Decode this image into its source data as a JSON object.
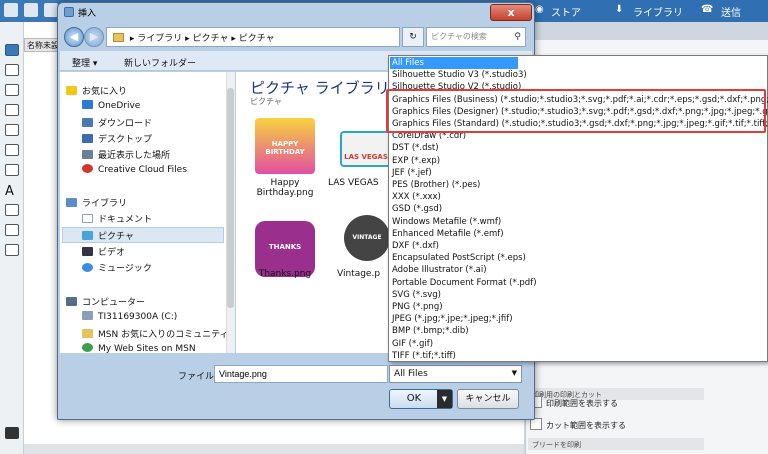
{
  "app": {
    "store_label": "ストア",
    "library_label": "ライブラリ",
    "send_label": "送信",
    "doc_tab": "名称未設"
  },
  "panel": {
    "print_section": "印刷用の印刷とカット",
    "show_print_area": "印刷範囲を表示する",
    "show_cut_area": "カット範囲を表示する",
    "blade_section": "ブリードを印刷"
  },
  "dialog": {
    "title": "挿入",
    "close": "x",
    "address": [
      "ライブラリ",
      "ピクチャ",
      "ピクチャ"
    ],
    "search_placeholder": "ピクチャの検索",
    "toolbar": {
      "organize": "整理 ▾",
      "new_folder": "新しいフォルダー"
    },
    "sidebar": {
      "favorites": "お気に入り",
      "onedrive": "OneDrive",
      "downloads": "ダウンロード",
      "desktop": "デスクトップ",
      "recent": "最近表示した場所",
      "creative_cloud": "Creative Cloud Files",
      "libraries": "ライブラリ",
      "documents": "ドキュメント",
      "pictures": "ピクチャ",
      "videos": "ビデオ",
      "music": "ミュージック",
      "computer": "コンピューター",
      "drive_c": "TI31169300A (C:)",
      "msn_community": "MSN お気に入りのコミュニティ",
      "msn_sites": "My Web Sites on MSN"
    },
    "library_title": "ピクチャ ライブラリ",
    "library_subtitle": "ピクチャ",
    "files": [
      {
        "name": "Happy\nBirthday.png",
        "thumb": "HAPPY BIRTHDAY"
      },
      {
        "name": "LAS VEGAS",
        "thumb": "LAS VEGAS"
      },
      {
        "name": "Thanks.png",
        "thumb": "THANKS"
      },
      {
        "name": "Vintage.p",
        "thumb": "VINTAGE"
      }
    ],
    "filename_label": "ファイル名(N):",
    "filename_value": "Vintage.png",
    "filetype_value": "All Files",
    "ok_label": "OK",
    "cancel_label": "キャンセル"
  },
  "filetype_options": [
    "All Files",
    "Silhouette Studio V3 (*.studio3)",
    "Silhouette Studio V2 (*.studio)",
    "Graphics Files (Business) (*.studio;*.studio3;*.svg;*.pdf;*.ai;*.cdr;*.eps;*.gsd;*.dxf;*.png;*.j",
    "Graphics Files (Designer) (*.studio;*.studio3;*.svg;*.pdf;*.gsd;*.dxf;*.png;*.jpg;*.jpeg;*.gif;*",
    "Graphics Files (Standard) (*.studio;*.studio3;*.gsd;*.dxf;*.png;*.jpg;*.jpeg;*.gif;*.tif;*.tiff;*.",
    "CorelDraw (*.cdr)",
    "DST (*.dst)",
    "EXP (*.exp)",
    "JEF (*.jef)",
    "PES (Brother) (*.pes)",
    "XXX (*.xxx)",
    "GSD (*.gsd)",
    "Windows Metafile (*.wmf)",
    "Enhanced Metafile (*.emf)",
    "DXF (*.dxf)",
    "Encapsulated PostScript (*.eps)",
    "Adobe Illustrator (*.ai)",
    "Portable Document Format (*.pdf)",
    "SVG (*.svg)",
    "PNG (*.png)",
    "JPEG (*.jpg;*.jpe;*.jpeg;*.jfif)",
    "BMP (*.bmp;*.dib)",
    "GIF (*.gif)",
    "TIFF (*.tif;*.tiff)"
  ],
  "colors": {
    "accent": "#3399ff",
    "highlight_box": "#e23b3b",
    "title_blue": "#1e3287"
  }
}
